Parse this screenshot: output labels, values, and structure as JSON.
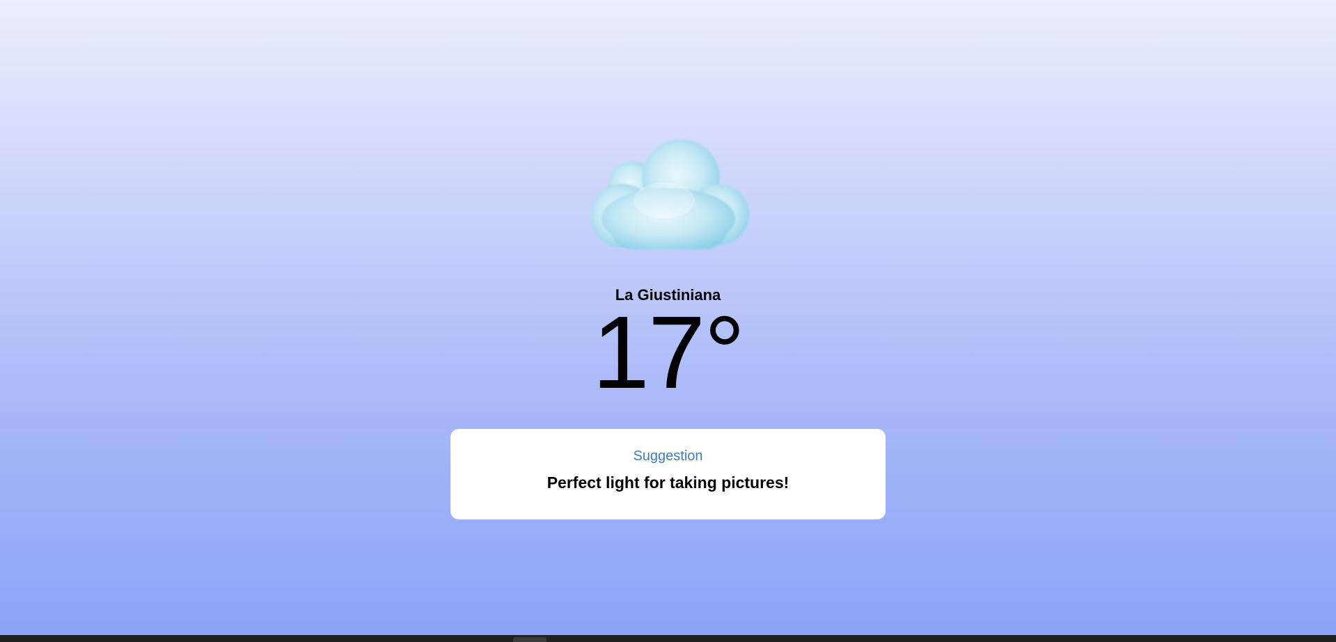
{
  "weather": {
    "icon": "cloud-icon",
    "location": "La Giustiniana",
    "temperature": "17°"
  },
  "suggestion": {
    "title": "Suggestion",
    "text": "Perfect light for taking pictures!"
  },
  "colors": {
    "background_top": "#eceffd",
    "background_bottom": "#8aa4f7",
    "card_background": "#ffffff",
    "suggestion_title": "#3d7dbf",
    "text": "#000000",
    "cloud": "#bfe6f3",
    "taskbar": "#202124"
  }
}
